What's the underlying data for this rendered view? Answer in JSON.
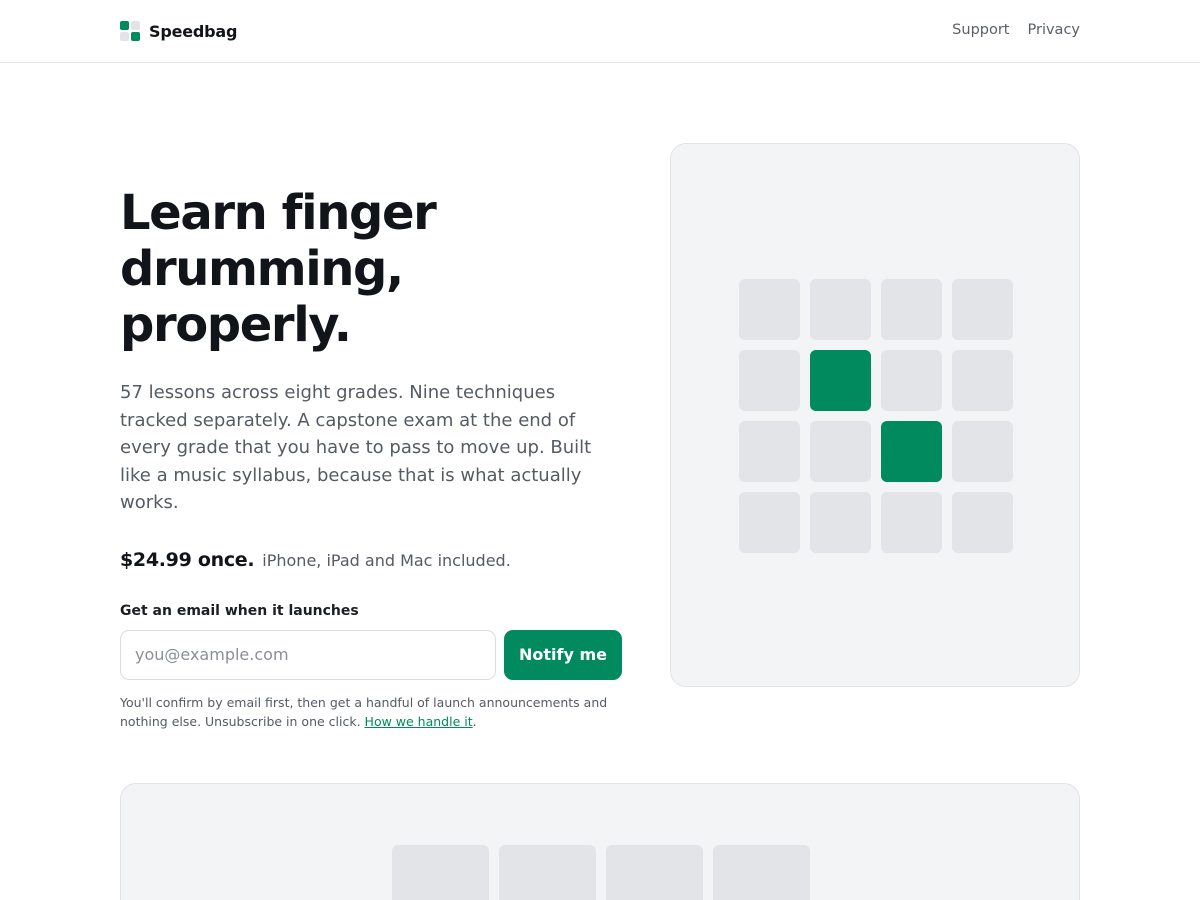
{
  "brand": {
    "name": "Speedbag",
    "logo_colors": [
      "#008a5e",
      "#e2e4e8",
      "#e2e4e8",
      "#008a5e"
    ]
  },
  "nav": {
    "items": [
      {
        "label": "Support"
      },
      {
        "label": "Privacy"
      }
    ]
  },
  "hero": {
    "headline_line1": "Learn finger",
    "headline_line2": "drumming, properly.",
    "lede": "57 lessons across eight grades. Nine techniques tracked separately. A capstone exam at the end of every grade that you have to pass to move up. Built like a music syllabus, because that is what actually works.",
    "price": "$24.99 once.",
    "price_note": "iPhone, iPad and Mac included."
  },
  "signup": {
    "label": "Get an email when it launches",
    "email_value": "",
    "email_placeholder": "you@example.com",
    "button_label": "Notify me",
    "fineprint": "You'll confirm by email first, then get a handful of launch announcements and nothing else. Unsubscribe in one click.",
    "fineprint_link": "How we handle it",
    "fineprint_end": "."
  },
  "pad_grid": {
    "rows": 4,
    "cols": 4,
    "active": [
      [
        1,
        1
      ],
      [
        2,
        2
      ]
    ]
  },
  "colors": {
    "accent": "#008a5e",
    "pad_idle": "#e2e4e8",
    "card_bg": "#f3f4f6",
    "text": "#111418",
    "muted": "#555b63"
  }
}
